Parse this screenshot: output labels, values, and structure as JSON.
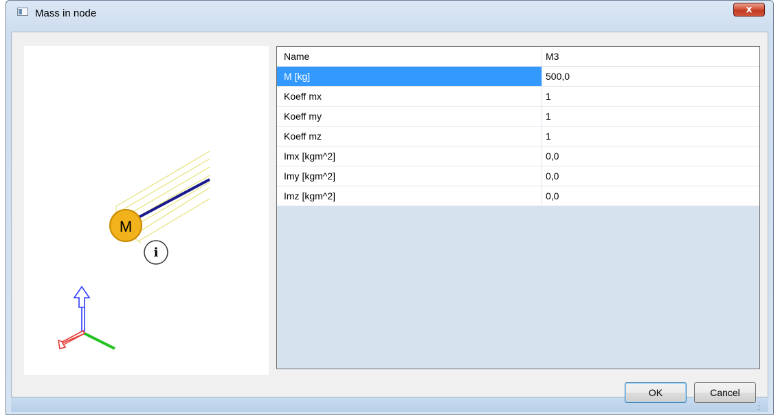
{
  "window": {
    "title": "Mass in node",
    "close_label": "x"
  },
  "preview": {
    "mass_label": "M",
    "node_label": "i"
  },
  "properties": [
    {
      "name": "Name",
      "value": "M3"
    },
    {
      "name": "M [kg]",
      "value": "500,0",
      "selected": true
    },
    {
      "name": "Koeff mx",
      "value": "1"
    },
    {
      "name": "Koeff my",
      "value": "1"
    },
    {
      "name": "Koeff mz",
      "value": "1"
    },
    {
      "name": "Imx [kgm^2]",
      "value": "0,0"
    },
    {
      "name": "Imy [kgm^2]",
      "value": "0,0"
    },
    {
      "name": "Imz [kgm^2]",
      "value": "0,0"
    }
  ],
  "buttons": {
    "ok": "OK",
    "cancel": "Cancel"
  },
  "colors": {
    "selection": "#3399ff",
    "beam_outline": "#e6e27a",
    "beam_axis": "#1a1a8c",
    "mass_marker": "#f2b21b",
    "axis_x": "#e53935",
    "axis_y": "#22c322",
    "axis_z": "#2f3cff"
  }
}
